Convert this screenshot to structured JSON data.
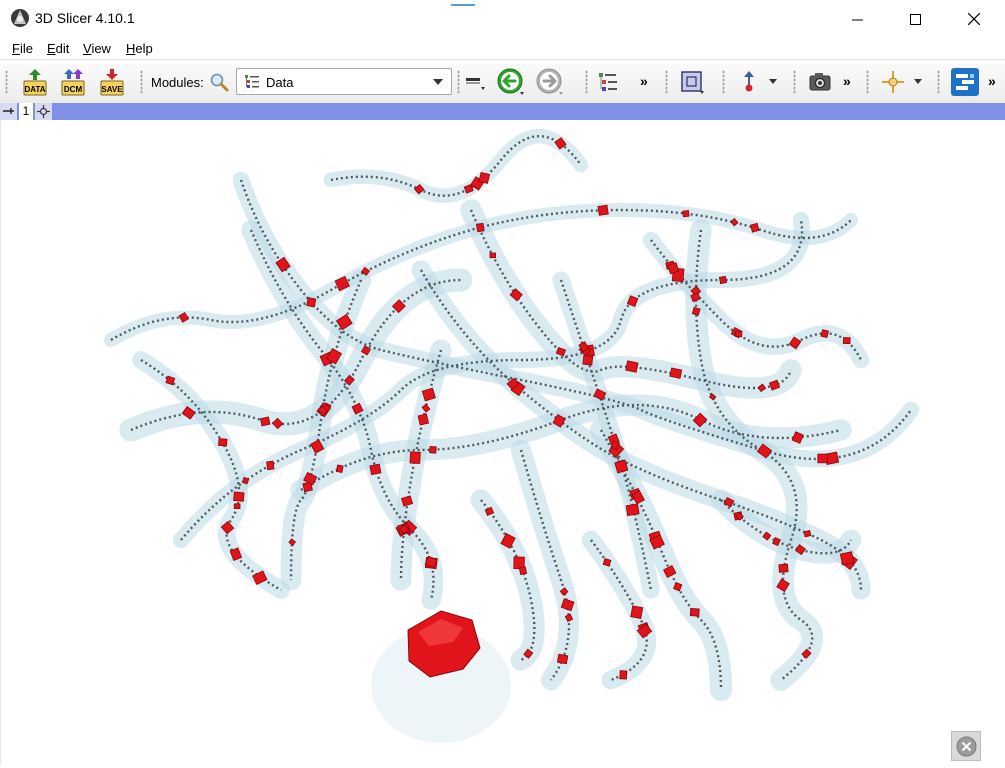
{
  "window": {
    "title": "3D Slicer 4.10.1"
  },
  "menu": {
    "items": [
      {
        "label": "File",
        "mnemonic": "F",
        "rest": "ile"
      },
      {
        "label": "Edit",
        "mnemonic": "E",
        "rest": "dit"
      },
      {
        "label": "View",
        "mnemonic": "V",
        "rest": "iew"
      },
      {
        "label": "Help",
        "mnemonic": "H",
        "rest": "elp"
      }
    ]
  },
  "toolbar": {
    "load_data_label": "DATA",
    "load_dicom_label": "DCM",
    "save_label": "SAVE",
    "modules_label": "Modules:",
    "selected_module": "Data",
    "overflow_glyph": "»"
  },
  "view": {
    "number": "1"
  },
  "colors": {
    "accent": "#8090e8",
    "vessel_outline": "#bcd8e6",
    "vessel_centerline": "#4f5a5c",
    "bifurcation_marker": "#e0141a",
    "back_arrow": "#2fa52f"
  }
}
